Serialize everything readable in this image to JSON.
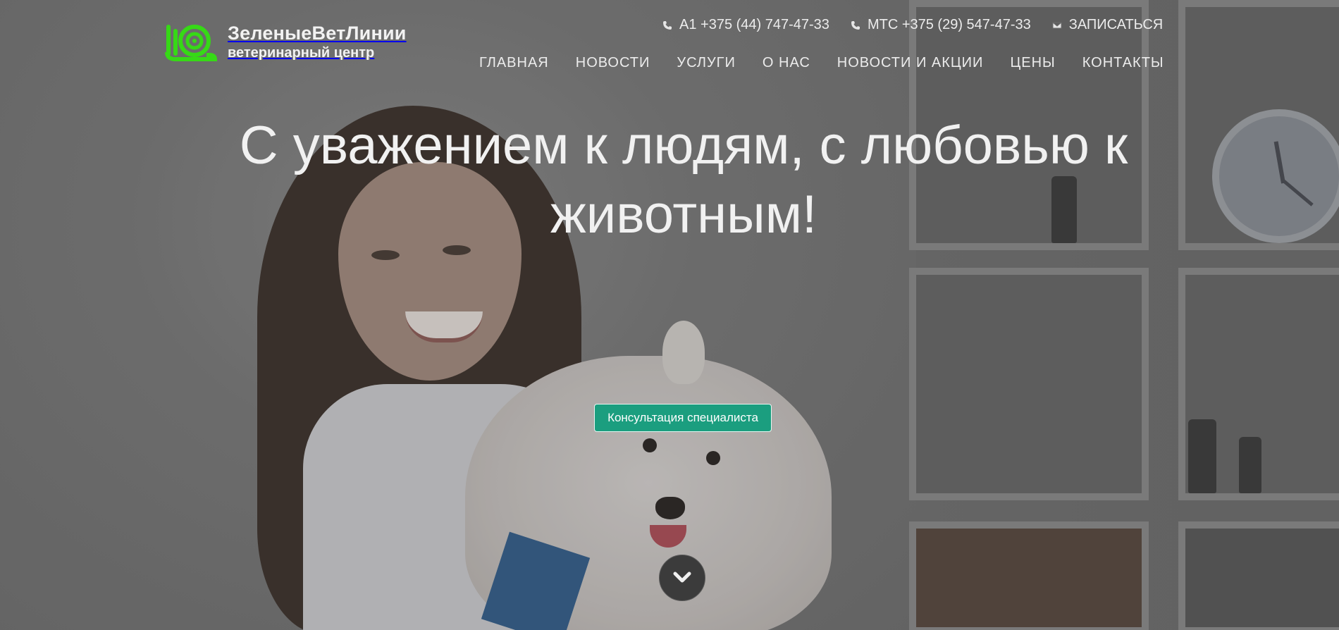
{
  "brand": {
    "name": "ЗеленыеВетЛинии",
    "tagline": "ветеринарный центр",
    "logo_icon": "snail-icon",
    "logo_color": "#36d916"
  },
  "contacts": [
    {
      "icon": "phone-icon",
      "label": "А1 +375 (44) 747-47-33"
    },
    {
      "icon": "phone-icon",
      "label": "МТС +375 (29) 547-47-33"
    },
    {
      "icon": "envelope-icon",
      "label": "ЗАПИСАТЬСЯ"
    }
  ],
  "nav": {
    "items": [
      {
        "label": "ГЛАВНАЯ"
      },
      {
        "label": "НОВОСТИ"
      },
      {
        "label": "УСЛУГИ"
      },
      {
        "label": "О НАС"
      },
      {
        "label": "НОВОСТИ И АКЦИИ"
      },
      {
        "label": "ЦЕНЫ"
      },
      {
        "label": "КОНТАКТЫ"
      }
    ]
  },
  "hero": {
    "headline": "С уважением к людям, с любовью к животным!",
    "cta_label": "Консультация специалиста",
    "cta_color": "#1b9e7f",
    "scroll_icon": "chevron-down-icon"
  }
}
